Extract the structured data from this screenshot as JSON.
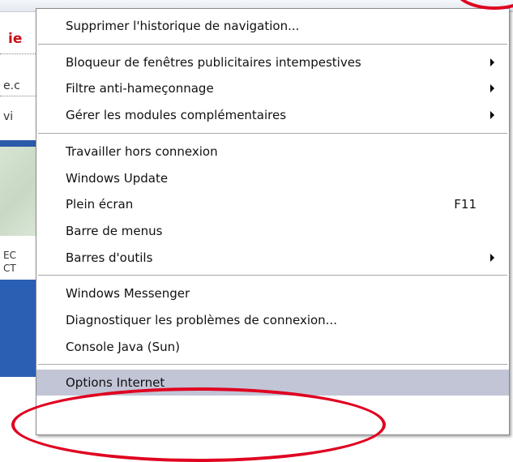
{
  "background": {
    "fragments": [
      "ie",
      "e.c",
      "vi",
      "EC",
      "CT"
    ]
  },
  "menu": {
    "groups": [
      [
        {
          "label": "Supprimer l'historique de navigation...",
          "shortcut": "",
          "submenu": false
        }
      ],
      [
        {
          "label": "Bloqueur de fenêtres publicitaires intempestives",
          "shortcut": "",
          "submenu": true
        },
        {
          "label": "Filtre anti-hameçonnage",
          "shortcut": "",
          "submenu": true
        },
        {
          "label": "Gérer les modules complémentaires",
          "shortcut": "",
          "submenu": true
        }
      ],
      [
        {
          "label": "Travailler hors connexion",
          "shortcut": "",
          "submenu": false
        },
        {
          "label": "Windows Update",
          "shortcut": "",
          "submenu": false
        },
        {
          "label": "Plein écran",
          "shortcut": "F11",
          "submenu": false
        },
        {
          "label": "Barre de menus",
          "shortcut": "",
          "submenu": false
        },
        {
          "label": "Barres d'outils",
          "shortcut": "",
          "submenu": true
        }
      ],
      [
        {
          "label": "Windows Messenger",
          "shortcut": "",
          "submenu": false
        },
        {
          "label": "Diagnostiquer les problèmes de connexion...",
          "shortcut": "",
          "submenu": false
        },
        {
          "label": "Console Java (Sun)",
          "shortcut": "",
          "submenu": false
        }
      ],
      [
        {
          "label": "Options Internet",
          "shortcut": "",
          "submenu": false,
          "highlighted": true
        }
      ]
    ]
  },
  "colors": {
    "highlight": "#c1c5d6",
    "annotation": "#e00020"
  }
}
